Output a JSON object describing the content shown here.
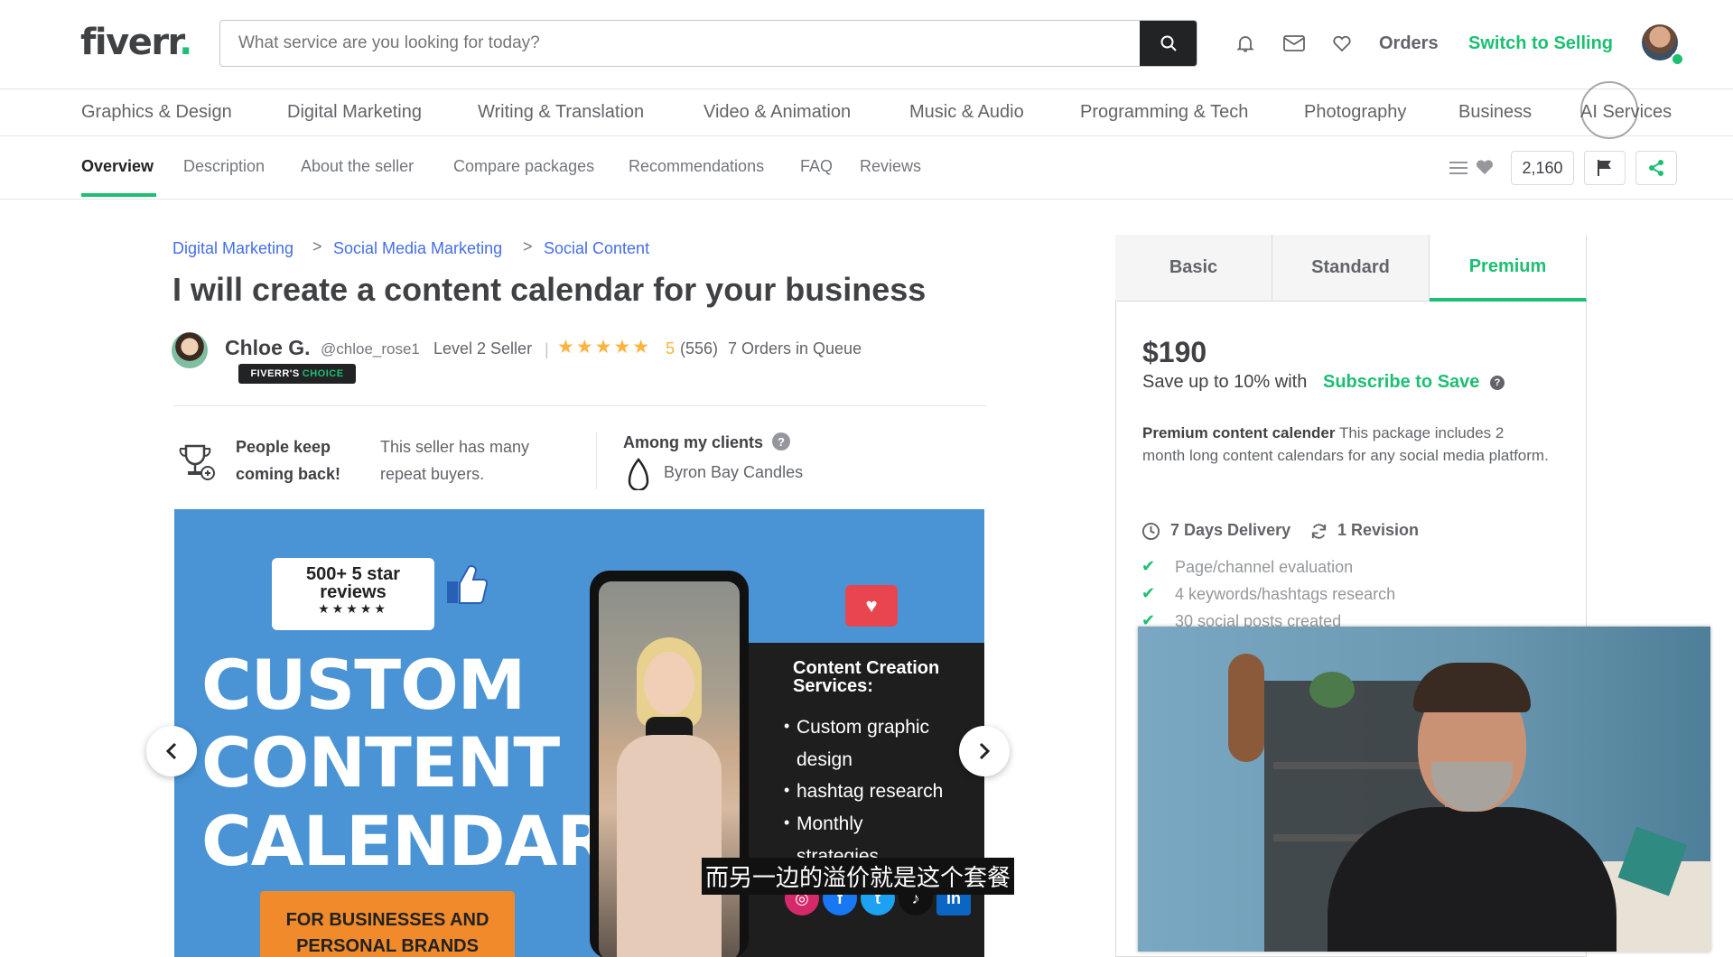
{
  "header": {
    "logo": "fiverr",
    "logo_dot": ".",
    "search_placeholder": "What service are you looking for today?",
    "orders": "Orders",
    "switch_selling": "Switch to Selling",
    "icons": [
      "search-icon",
      "bell-icon",
      "mail-icon",
      "heart-icon"
    ]
  },
  "categories": [
    "Graphics & Design",
    "Digital Marketing",
    "Writing & Translation",
    "Video & Animation",
    "Music & Audio",
    "Programming & Tech",
    "Photography",
    "Business",
    "AI Services"
  ],
  "tabs": [
    "Overview",
    "Description",
    "About the seller",
    "Compare packages",
    "Recommendations",
    "FAQ",
    "Reviews"
  ],
  "active_tab": "Overview",
  "like_count": "2,160",
  "breadcrumb": [
    "Digital Marketing",
    "Social Media Marketing",
    "Social Content"
  ],
  "breadcrumb_sep": ">",
  "gig": {
    "title": "I will create a content calendar for your business"
  },
  "seller": {
    "name": "Chloe G.",
    "handle": "@chloe_rose1",
    "level": "Level 2 Seller",
    "separator": "|",
    "stars": "★★★★★",
    "rating": "5",
    "reviews": "(556)",
    "queue": "7 Orders in Queue",
    "badge_left": "FIVERR'S",
    "badge_right": "CHOICE"
  },
  "highlights": {
    "people_keep": "People keep coming back!",
    "repeat": "This seller has many repeat buyers.",
    "among": "Among my clients",
    "question": "?",
    "client": "Byron Bay Candles"
  },
  "gallery": {
    "bubble_title": "500+ 5 star reviews",
    "bubble_stars": "★★★★★",
    "words": [
      "CUSTOM",
      "CONTENT",
      "CALENDAR"
    ],
    "promo": "FOR BUSINESSES AND PERSONAL BRANDS",
    "services_title": "Content Creation Services:",
    "services": [
      "Custom graphic",
      "design",
      "hashtag research",
      "Monthly",
      "strategies"
    ],
    "bullet": "•",
    "social": [
      "◎",
      "f",
      "t",
      "♪",
      "in"
    ]
  },
  "pricing": {
    "packages": [
      "Basic",
      "Standard",
      "Premium"
    ],
    "active_package": "Premium",
    "price": "$190",
    "save_text": "Save up to 10% with",
    "subscribe": "Subscribe to Save",
    "save_q": "?",
    "desc_bold": "Premium content calender",
    "desc": "This package includes 2 month long content calendars for any social media platform.",
    "delivery": "7 Days Delivery",
    "revision": "1 Revision",
    "check": "✔",
    "features": [
      "Page/channel evaluation",
      "4 keywords/hashtags research",
      "30 social posts created"
    ]
  },
  "subtitle": "而另一边的溢价就是这个套餐",
  "colors": {
    "brand_green": "#1dbf73",
    "link_blue": "#446ee7",
    "star": "#ffb33e",
    "text_dark": "#404145"
  }
}
